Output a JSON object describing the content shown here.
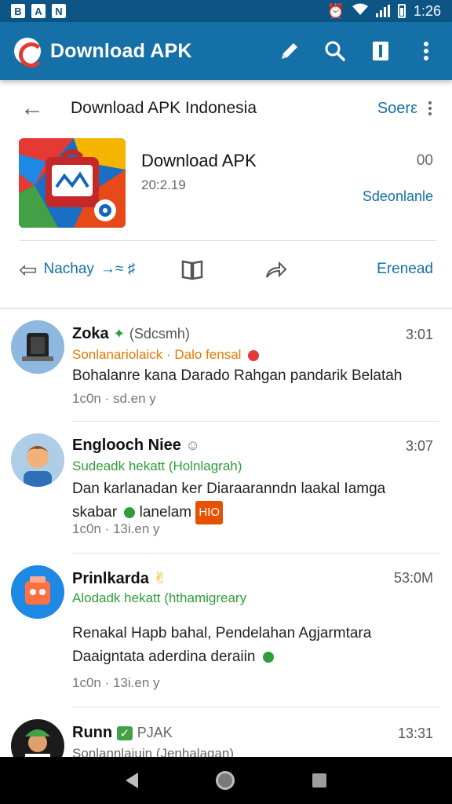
{
  "status_bar": {
    "time": "1:26",
    "notif_icons": [
      "B",
      "A",
      "N"
    ]
  },
  "app_bar": {
    "title": "Download APK",
    "icons": [
      "edit-icon",
      "search-icon",
      "bookmark-icon",
      "more-vert-icon"
    ]
  },
  "sub_header": {
    "title": "Download APK Indonesia",
    "action": "Soerε"
  },
  "app_card": {
    "name": "Download APK",
    "date": "20:2.19",
    "count": "00",
    "link": "Sdeonlanle"
  },
  "actions": {
    "reply_label": "Nachay",
    "reply_suffix": "→≈ ♯",
    "share_label": "Erenead"
  },
  "messages": [
    {
      "name": "Zoka",
      "handle": "(Sdcsmh)",
      "time": "3:01",
      "subtitle": "Sonlanariolaick · Dalo fensal",
      "subtitle_color": "#e67a00",
      "body_line1": "Bohalanre kana Darado Rahgan pandarik Belatah",
      "body_line2": "",
      "meta": "1c0n · sd.en y"
    },
    {
      "name": "Englooch Niee",
      "handle": "",
      "time": "3:07",
      "subtitle": "Sudeadk hekatt (Holnlagrah)",
      "subtitle_color": "#2e9d3a",
      "body_line1": "Dan karlanadan ker Diaraaranndn laakal Iamga",
      "body_line2": "skabar",
      "body_extra": "lanelam",
      "tag": "HIO",
      "meta": "1c0n · 13i.en y"
    },
    {
      "name": "Prinlkarda",
      "handle": "",
      "time": "53:0M",
      "subtitle": "Alodadk hekatt (hthamigreary",
      "subtitle_color": "#2e9d3a",
      "body_line1": "Renakal Hapb bahal, Pendelahan Agjarmtara",
      "body_line2": "Daaigntata aderdina deraiin",
      "meta": "1c0n · 13i.en y"
    },
    {
      "name": "Runn",
      "handle": "PJAK",
      "time": "13:31",
      "subtitle": "Sonlannlaiuin (Jenhalagan)",
      "subtitle_color": "#666666",
      "body_line1": "",
      "body_line2": "",
      "meta": ""
    }
  ],
  "nav_bar": {
    "icons": [
      "back-icon",
      "home-icon",
      "recents-icon"
    ]
  }
}
